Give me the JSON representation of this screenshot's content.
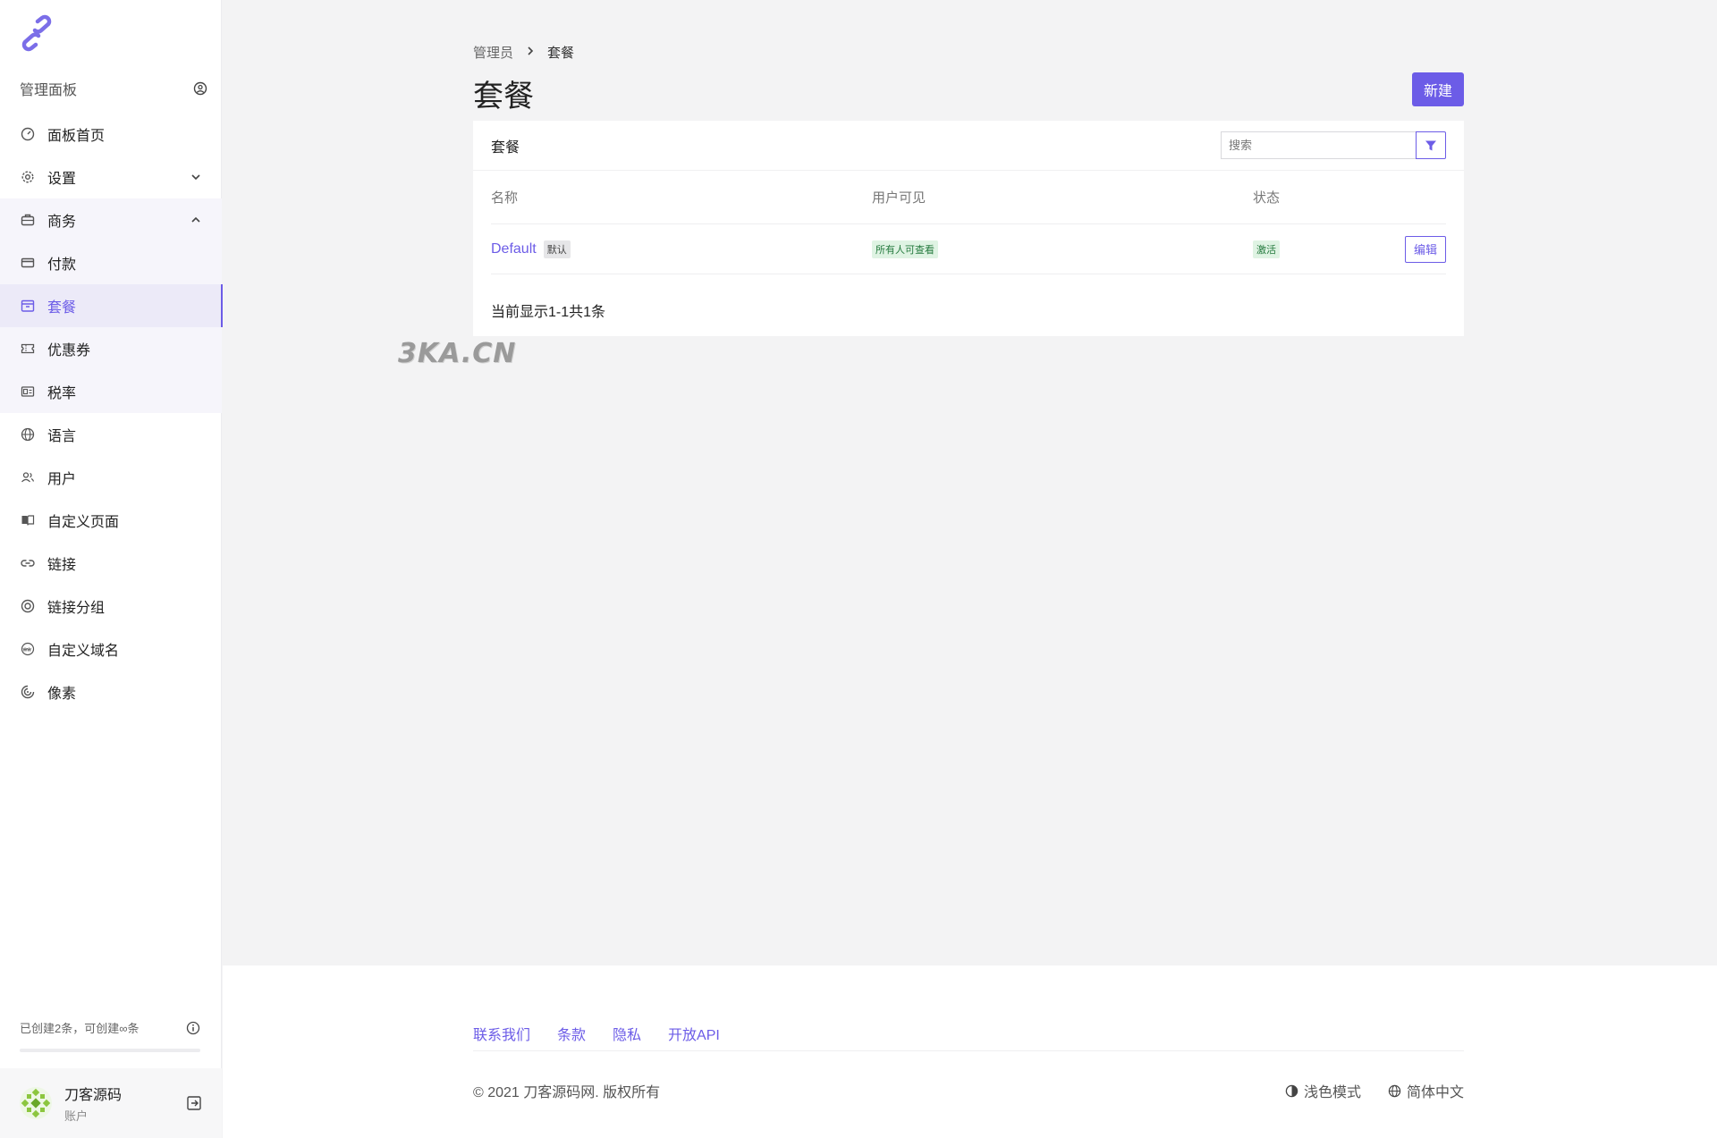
{
  "sidebar": {
    "panel_title": "管理面板",
    "items": [
      {
        "label": "面板首页",
        "icon": "dashboard-icon"
      },
      {
        "label": "设置",
        "icon": "gear-icon"
      },
      {
        "label": "商务",
        "icon": "briefcase-icon"
      },
      {
        "label": "付款",
        "icon": "credit-card-icon"
      },
      {
        "label": "套餐",
        "icon": "package-icon"
      },
      {
        "label": "优惠券",
        "icon": "ticket-icon"
      },
      {
        "label": "税率",
        "icon": "receipt-icon"
      },
      {
        "label": "语言",
        "icon": "globe-icon"
      },
      {
        "label": "用户",
        "icon": "users-icon"
      },
      {
        "label": "自定义页面",
        "icon": "book-icon"
      },
      {
        "label": "链接",
        "icon": "link-icon"
      },
      {
        "label": "链接分组",
        "icon": "target-icon"
      },
      {
        "label": "自定义域名",
        "icon": "www-icon"
      },
      {
        "label": "像素",
        "icon": "pixel-icon"
      }
    ],
    "active_item": "套餐",
    "quota_text": "已创建2条，可创建∞条",
    "account_name": "刀客源码",
    "account_role": "账户"
  },
  "breadcrumb": {
    "parent": "管理员",
    "current": "套餐"
  },
  "page_title": "套餐",
  "new_button": "新建",
  "card": {
    "title": "套餐",
    "search_placeholder": "搜索",
    "columns": [
      "名称",
      "用户可见",
      "状态"
    ],
    "rows": [
      {
        "name": "Default",
        "name_badge": "默认",
        "visibility": "所有人可查看",
        "status": "激活",
        "action": "编辑"
      }
    ],
    "count_text": "当前显示1-1共1条"
  },
  "watermark": "3KA.CN",
  "footer": {
    "links": [
      "联系我们",
      "条款",
      "隐私",
      "开放API"
    ],
    "copyright": "© 2021 刀客源码网. 版权所有",
    "theme_label": "浅色模式",
    "language_label": "简体中文"
  },
  "colors": {
    "accent": "#6c5ce7",
    "background": "#f3f3f4",
    "success_bg": "#dff3e3"
  }
}
